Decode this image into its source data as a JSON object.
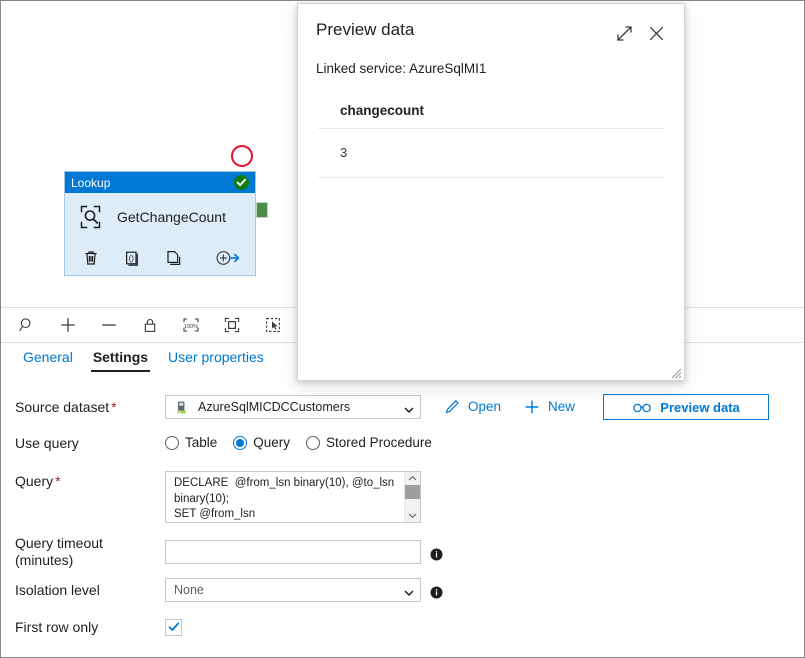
{
  "canvas": {
    "activity": {
      "type_label": "Lookup",
      "name": "GetChangeCount",
      "status_icon": "check-icon",
      "actions": [
        {
          "name": "delete",
          "icon": "trash-icon"
        },
        {
          "name": "code",
          "icon": "code-brackets-icon"
        },
        {
          "name": "clone",
          "icon": "copy-icon"
        },
        {
          "name": "add-output",
          "icon": "add-output-arrow-icon"
        }
      ]
    },
    "annotation": {
      "shape": "circle",
      "color": "#e81123"
    },
    "toolbar": [
      {
        "name": "zoom-search",
        "icon": "search-icon"
      },
      {
        "name": "zoom-in",
        "icon": "plus-icon"
      },
      {
        "name": "zoom-out",
        "icon": "minus-icon"
      },
      {
        "name": "lock-canvas",
        "icon": "lock-icon"
      },
      {
        "name": "zoom-100",
        "icon": "zoom-100-icon",
        "label": "100%"
      },
      {
        "name": "zoom-to-fit",
        "icon": "fit-to-screen-icon"
      },
      {
        "name": "select-mode",
        "icon": "marquee-select-icon"
      }
    ]
  },
  "tabs": [
    {
      "label": "General",
      "active": false
    },
    {
      "label": "Settings",
      "active": true
    },
    {
      "label": "User properties",
      "active": false
    }
  ],
  "settings": {
    "source_dataset": {
      "label": "Source dataset",
      "required": true,
      "value": "AzureSqlMICDCCustomers",
      "icon": "database-icon",
      "open_label": "Open",
      "open_icon": "pencil-icon",
      "new_label": "New",
      "new_icon": "plus-icon",
      "preview_label": "Preview data",
      "preview_icon": "glasses-icon"
    },
    "use_query": {
      "label": "Use query",
      "options": [
        {
          "label": "Table",
          "selected": false
        },
        {
          "label": "Query",
          "selected": true
        },
        {
          "label": "Stored Procedure",
          "selected": false
        }
      ]
    },
    "query": {
      "label": "Query",
      "required": true,
      "value": "DECLARE  @from_lsn binary(10), @to_lsn binary(10);\nSET @from_lsn"
    },
    "query_timeout": {
      "label": "Query timeout (minutes)",
      "value": "",
      "info_icon": "info-icon"
    },
    "isolation_level": {
      "label": "Isolation level",
      "value": "None",
      "info_icon": "info-icon"
    },
    "first_row_only": {
      "label": "First row only",
      "checked": true
    }
  },
  "preview_panel": {
    "title": "Preview data",
    "expand_icon": "expand-diagonal-icon",
    "close_icon": "close-icon",
    "linked_service": "Linked service: AzureSqlMI1",
    "table": {
      "columns": [
        "changecount"
      ],
      "rows": [
        [
          "3"
        ]
      ]
    }
  },
  "colors": {
    "accent": "#0078d4",
    "node_header": "#0078d4",
    "node_body": "#deecf9",
    "status_green": "#107c10",
    "connector_green": "#4c8c46",
    "annotation_red": "#e81123",
    "required_red": "#a4262c"
  }
}
